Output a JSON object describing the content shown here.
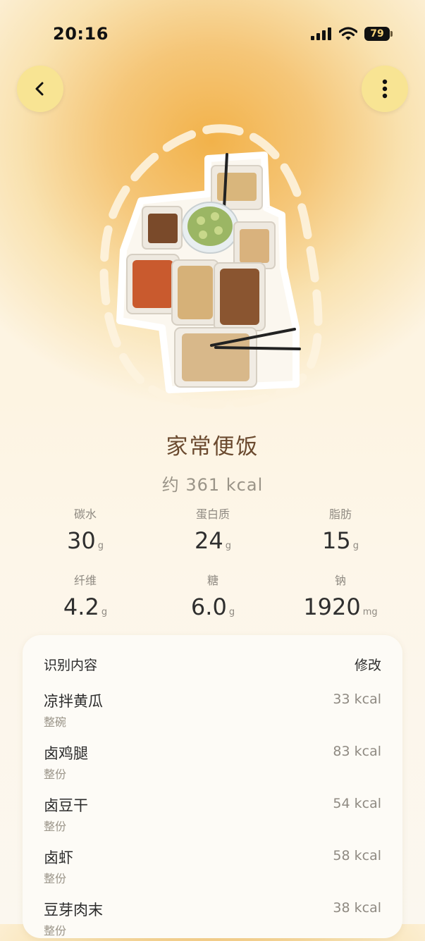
{
  "status": {
    "time": "20:16",
    "battery": "79"
  },
  "meal": {
    "name": "家常便饭",
    "kcal": "约 361 kcal"
  },
  "nutrients": [
    {
      "label": "碳水",
      "value": "30",
      "unit": "g"
    },
    {
      "label": "蛋白质",
      "value": "24",
      "unit": "g"
    },
    {
      "label": "脂肪",
      "value": "15",
      "unit": "g"
    },
    {
      "label": "纤维",
      "value": "4.2",
      "unit": "g"
    },
    {
      "label": "糖",
      "value": "6.0",
      "unit": "g"
    },
    {
      "label": "钠",
      "value": "1920",
      "unit": "mg"
    }
  ],
  "recognized": {
    "title": "识别内容",
    "edit_label": "修改",
    "items": [
      {
        "name": "凉拌黄瓜",
        "portion": "整碗",
        "kcal": "33 kcal"
      },
      {
        "name": "卤鸡腿",
        "portion": "整份",
        "kcal": "83 kcal"
      },
      {
        "name": "卤豆干",
        "portion": "整份",
        "kcal": "54 kcal"
      },
      {
        "name": "卤虾",
        "portion": "整份",
        "kcal": "58 kcal"
      },
      {
        "name": "豆芽肉末",
        "portion": "整份",
        "kcal": "38 kcal"
      }
    ]
  },
  "colors": {
    "button_bg": "#f8e493",
    "title_brown": "#6b4a2f",
    "accent_orange": "#f2b24a"
  },
  "icons": [
    "signal-icon",
    "wifi-icon",
    "battery-icon",
    "back-icon",
    "more-icon"
  ]
}
